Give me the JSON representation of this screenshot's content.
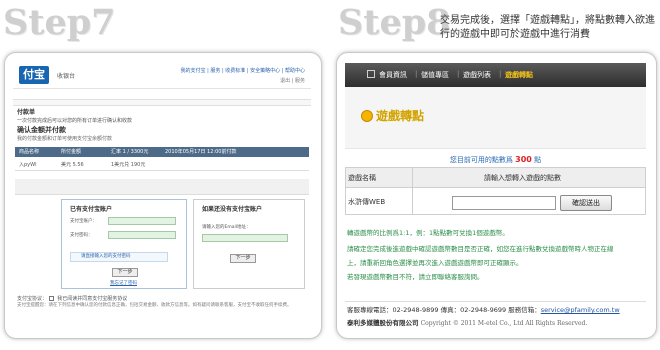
{
  "step7": {
    "label": "Step7"
  },
  "step8": {
    "label": "Step8",
    "description": "交易完成後，選擇「遊戲轉點」，將點數轉入欲進行的遊戲中即可於遊戲中進行消費"
  },
  "alipay": {
    "logo": "付宝",
    "cashier": "收银台",
    "top_links": "我的支付宝 | 服务 | 收费标准 | 安全策略中心 | 帮助中心",
    "top_sub": "退出 | 服务",
    "section_bar": "",
    "order_title": "付款单",
    "order_note": "一次付款完成后可以对您的所有订单进行确认和收款",
    "pay_title": "确认金额并付款",
    "pay_note": "我的付款金额和订单可使用支付宝余额付款",
    "table_headers": [
      "商品名称",
      "所付金额",
      "汇率 1 / 3300元",
      "2010年05月17日 12:00前付款"
    ],
    "table_row": [
      "入pyWl",
      "美元 5.56",
      "1美元兑 190元",
      ""
    ],
    "login_box": {
      "title": "已有支付宝账户",
      "account_label": "支付宝账户：",
      "password_label": "支付密码：",
      "note": "请直接输入您的支付密码",
      "next_button": "下一步",
      "forgot_link": "我忘记了密码"
    },
    "new_box": {
      "title": "如果还没有支付宝账户",
      "email_label": "请输入您的Email地址：",
      "next_button": "下一步"
    },
    "agree_text": "我已阅读并同意支付宝服务协议",
    "agree_label": "支付宝协议：",
    "fine_print": "支付宝提醒您：请在下列信息中确认您的付款信息正确，包括交易金额、收款方信息等。如有疑问请联系客服，支付宝不收取任何手续费。"
  },
  "game": {
    "nav": [
      "會員資訊",
      "儲值專區",
      "遊戲列表",
      "遊戲轉點"
    ],
    "active_nav": "遊戲轉點",
    "title": "遊戲轉點",
    "points_prefix": "您目前可用的點數爲",
    "points_value": "300",
    "points_suffix": "點",
    "col_game": "遊戲名稱",
    "col_points": "請輸入想轉入遊戲的點數",
    "game_name": "水滸傳WEB",
    "points_input": "",
    "transfer_button": "確認送出",
    "rules": [
      "轉遊戲幣的比例爲1:1，例：1點點數可兌換1個遊戲幣。",
      "請確定您完成後進遊戲中確認遊戲幣數目是否正確，如您在進行點數兌換遊戲幣時人物正在線",
      "上，請重新回角色選擇並再次進入遊戲遊戲幣即可正確顯示。",
      "若發現遊戲幣數目不符，請立即聯絡客服詢問。"
    ],
    "footer": {
      "phone_text": "客服專線電話：02-2948-9899 傳真：02-2948-9699 服務信箱：",
      "email": "service@pfamily.com.tw",
      "company": "泰利多媒體股份有限公司",
      "copyright": "Copyright © 2011 M-etel Co., Ltd All Rights Reserved."
    }
  }
}
